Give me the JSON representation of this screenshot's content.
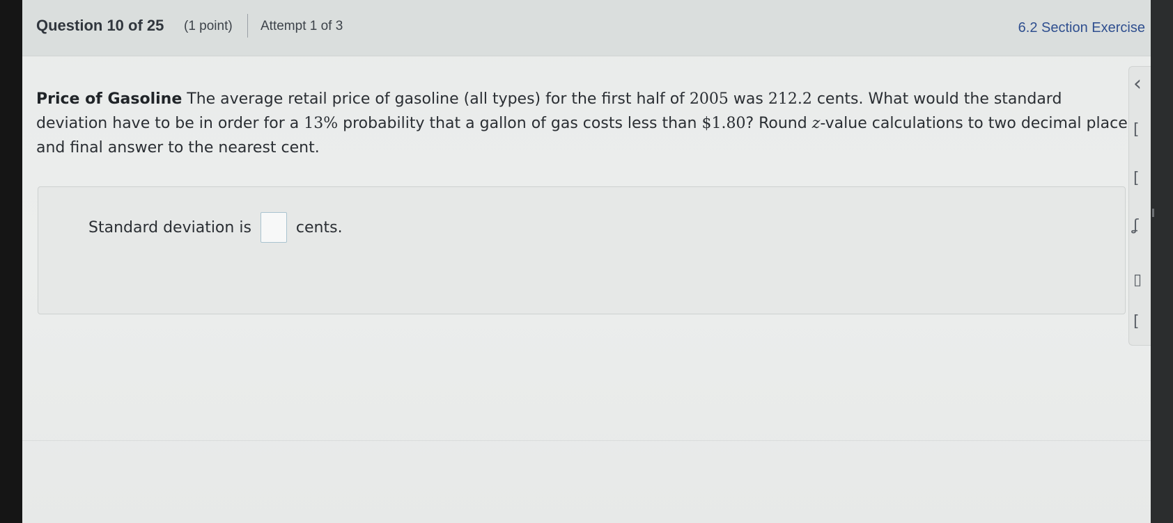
{
  "header": {
    "question_label": "Question 10 of 25",
    "points": "(1 point)",
    "attempt": "Attempt 1 of 3",
    "section": "6.2 Section Exercise"
  },
  "question": {
    "title": "Price of Gasoline",
    "text_1": " The average retail price of gasoline (all types) for the first half of ",
    "year": "2005",
    "text_2": " was ",
    "price": "212.2",
    "text_3": " cents. What would the standard deviation have to be in order for a ",
    "percent": "13%",
    "text_4": " probability that a gallon of gas costs less than ",
    "threshold": "$1.80",
    "text_5": "? Round ",
    "z_var": "z",
    "text_6": "-value calculations to two decimal places and final answer to the nearest cent."
  },
  "answer": {
    "prefix": "Standard deviation is",
    "input_value": "",
    "suffix": "cents."
  },
  "side_tools": {
    "collapse_icon": "chevron-left-icon",
    "glyph_collapse": "‹",
    "glyph_1": "[",
    "glyph_2": "[",
    "glyph_3": "ʆ",
    "glyph_4": "▯",
    "glyph_5": "["
  }
}
